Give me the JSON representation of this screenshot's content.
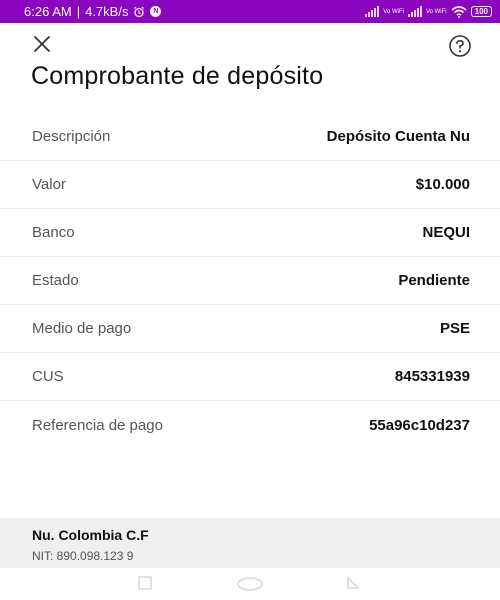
{
  "status_bar": {
    "time": "6:26 AM",
    "separator": "|",
    "speed": "4.7kB/s",
    "notification_badge": "N",
    "vowifi_1": "Vo WiFi",
    "vowifi_2": "Vo WiFi",
    "battery": "100",
    "background_color": "#8a05be"
  },
  "header": {
    "close_icon": "close-icon",
    "help_icon": "help-icon",
    "title": "Comprobante de depósito"
  },
  "details": [
    {
      "label": "Descripción",
      "value": "Depósito Cuenta Nu"
    },
    {
      "label": "Valor",
      "value": "$10.000"
    },
    {
      "label": "Banco",
      "value": "NEQUI"
    },
    {
      "label": "Estado",
      "value": "Pendiente"
    },
    {
      "label": "Medio de pago",
      "value": "PSE"
    },
    {
      "label": "CUS",
      "value": "845331939"
    },
    {
      "label": "Referencia de pago",
      "value": "55a96c10d237"
    }
  ],
  "footer": {
    "company": "Nu. Colombia C.F",
    "nit": "NIT: 890.098.123 9"
  },
  "nav": {
    "icons": [
      "recent-apps-icon",
      "home-icon",
      "back-icon"
    ]
  }
}
